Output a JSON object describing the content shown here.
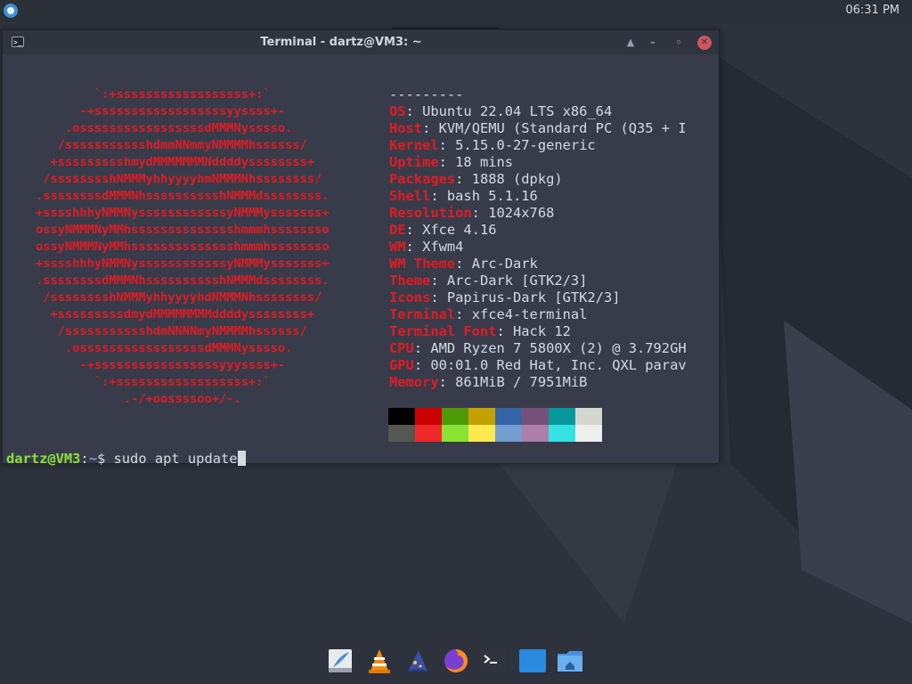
{
  "panel": {
    "clock": "06:31 PM"
  },
  "window": {
    "title": "Terminal - dartz@VM3: ~"
  },
  "terminal": {
    "logo_lines": [
      "            `:+ssssssssssssssssss+:`",
      "          -+ssssssssssssssssssyyssss+-",
      "        .osssssssssssssssssdMMMNysssso.",
      "       /ssssssssssshdmmNNmmyNMMMMhssssss/",
      "      +ssssssssshmydMMMMMMMNddddyssssssss+",
      "     /sssssssshNMMMyhhyyyyhmNMMMNhssssssss/",
      "    .ssssssssdMMMNhsssssssssshNMMMdssssssss.",
      "    +sssshhhyNMMNyssssssssssssyNMMMysssssss+",
      "    ossyNMMMNyMMhsssssssssssssshmmmhssssssso",
      "    ossyNMMMNyMMhsssssssssssssshmmmhssssssso",
      "    +sssshhhyNMMNyssssssssssssyNMMMysssssss+",
      "    .ssssssssdMMMNhsssssssssshNMMMdssssssss.",
      "     /sssssssshNMMMyhhyyyyhdNMMMNhssssssss/",
      "      +sssssssssdmydMMMMMMMMddddyssssssss+",
      "       /ssssssssssshdmNNNNmyNMMMMhssssss/",
      "        .osssssssssssssssssdMMMNysssso.",
      "          -+sssssssssssssssssyyyssss+-",
      "            `:+ssssssssssssssssss+:`",
      "                .-/+oossssoo+/-."
    ],
    "separator": "---------",
    "info": [
      {
        "key": "OS",
        "value": "Ubuntu 22.04 LTS x86_64"
      },
      {
        "key": "Host",
        "value": "KVM/QEMU (Standard PC (Q35 + I"
      },
      {
        "key": "Kernel",
        "value": "5.15.0-27-generic"
      },
      {
        "key": "Uptime",
        "value": "18 mins"
      },
      {
        "key": "Packages",
        "value": "1888 (dpkg)"
      },
      {
        "key": "Shell",
        "value": "bash 5.1.16"
      },
      {
        "key": "Resolution",
        "value": "1024x768"
      },
      {
        "key": "DE",
        "value": "Xfce 4.16"
      },
      {
        "key": "WM",
        "value": "Xfwm4"
      },
      {
        "key": "WM Theme",
        "value": "Arc-Dark"
      },
      {
        "key": "Theme",
        "value": "Arc-Dark [GTK2/3]"
      },
      {
        "key": "Icons",
        "value": "Papirus-Dark [GTK2/3]"
      },
      {
        "key": "Terminal",
        "value": "xfce4-terminal"
      },
      {
        "key": "Terminal Font",
        "value": "Hack 12"
      },
      {
        "key": "CPU",
        "value": "AMD Ryzen 7 5800X (2) @ 3.792GH"
      },
      {
        "key": "GPU",
        "value": "00:01.0 Red Hat, Inc. QXL parav"
      },
      {
        "key": "Memory",
        "value": "861MiB / 7951MiB"
      }
    ],
    "palette": [
      "#000000",
      "#cc0000",
      "#4e9a06",
      "#c4a000",
      "#3465a4",
      "#75507b",
      "#06989a",
      "#d3d7cf",
      "#555753",
      "#ef2929",
      "#8ae234",
      "#fce94f",
      "#729fcf",
      "#ad7fa8",
      "#34e2e2",
      "#eeeeec"
    ],
    "prompt": {
      "user_host": "dartz@VM3",
      "colon": ":",
      "path": "~",
      "symbol": "$ ",
      "command": "sudo apt update"
    }
  },
  "dock": {
    "items": [
      "text-editor-icon",
      "vlc-icon",
      "wizard-icon",
      "firefox-icon",
      "terminal-icon",
      "window-icon",
      "file-manager-icon"
    ]
  }
}
